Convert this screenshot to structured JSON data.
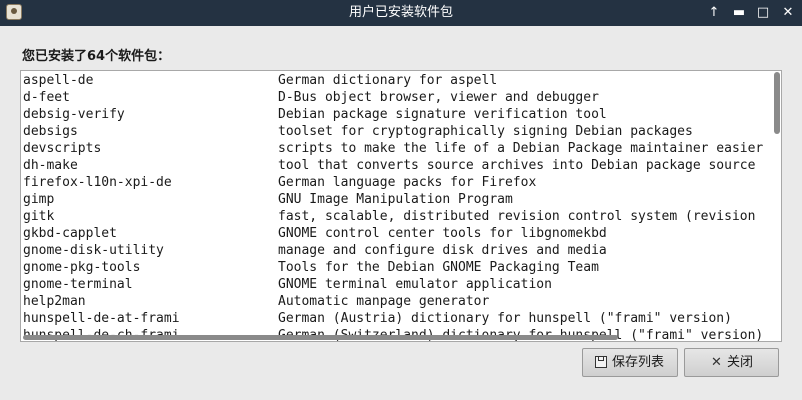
{
  "window": {
    "title": "用户已安装软件包",
    "controls": {
      "up": "↑",
      "minimize": "▬",
      "maximize": "□",
      "close": "✕"
    }
  },
  "heading": "您已安装了64个软件包：",
  "packages": [
    {
      "name": "aspell-de",
      "description": "German dictionary for aspell"
    },
    {
      "name": "d-feet",
      "description": "D-Bus object browser, viewer and debugger"
    },
    {
      "name": "debsig-verify",
      "description": "Debian package signature verification tool"
    },
    {
      "name": "debsigs",
      "description": "toolset for cryptographically signing Debian packages"
    },
    {
      "name": "devscripts",
      "description": "scripts to make the life of a Debian Package maintainer easier"
    },
    {
      "name": "dh-make",
      "description": "tool that converts source archives into Debian package source"
    },
    {
      "name": "firefox-l10n-xpi-de",
      "description": "German language packs for Firefox"
    },
    {
      "name": "gimp",
      "description": "GNU Image Manipulation Program"
    },
    {
      "name": "gitk",
      "description": "fast, scalable, distributed revision control system (revision"
    },
    {
      "name": "gkbd-capplet",
      "description": "GNOME control center tools for libgnomekbd"
    },
    {
      "name": "gnome-disk-utility",
      "description": "manage and configure disk drives and media"
    },
    {
      "name": "gnome-pkg-tools",
      "description": "Tools for the Debian GNOME Packaging Team"
    },
    {
      "name": "gnome-terminal",
      "description": "GNOME terminal emulator application"
    },
    {
      "name": "help2man",
      "description": "Automatic manpage generator"
    },
    {
      "name": "hunspell-de-at-frami",
      "description": "German (Austria) dictionary for hunspell (\"frami\" version)"
    },
    {
      "name": "hunspell-de-ch-frami",
      "description": "German (Switzerland) dictionary for hunspell (\"frami\" version)"
    }
  ],
  "buttons": {
    "save_label": "保存列表",
    "close_label": "关闭",
    "close_icon": "✕"
  }
}
